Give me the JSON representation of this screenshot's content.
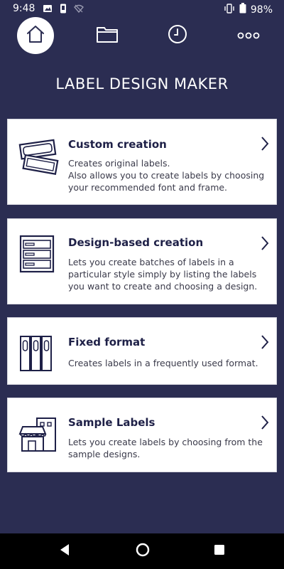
{
  "status_bar": {
    "time": "9:48",
    "battery": "98%"
  },
  "nav": {
    "tabs": [
      {
        "icon": "home-icon",
        "selected": true
      },
      {
        "icon": "folder-icon",
        "selected": false
      },
      {
        "icon": "clock-icon",
        "selected": false
      },
      {
        "icon": "more-icon",
        "selected": false
      }
    ]
  },
  "title": "LABEL DESIGN MAKER",
  "cards": [
    {
      "icon": "custom-label-icon",
      "title": "Custom creation",
      "description": "Creates original labels.\nAlso allows you to create labels by choosing your recommended font and frame."
    },
    {
      "icon": "cabinet-icon",
      "title": "Design-based creation",
      "description": "Lets you create batches of labels in a particular style simply by listing the labels you want to create and choosing a design."
    },
    {
      "icon": "binders-icon",
      "title": "Fixed format",
      "description": "Creates labels in a frequently used format."
    },
    {
      "icon": "storefront-icon",
      "title": "Sample Labels",
      "description": "Lets you create labels by choosing from the sample designs."
    }
  ],
  "colors": {
    "background": "#2b2d52",
    "icon_navy": "#1e2047",
    "card": "#ffffff"
  }
}
